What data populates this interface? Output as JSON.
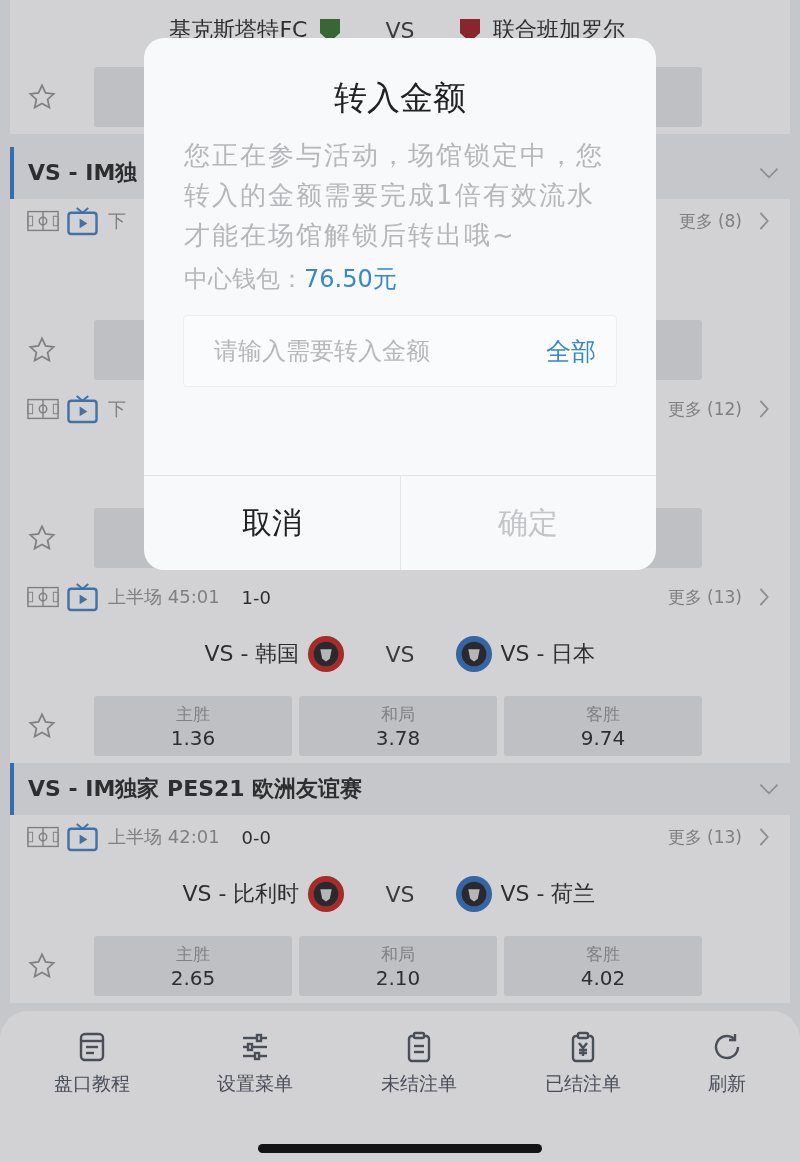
{
  "top_match": {
    "home": "基克斯塔特FC",
    "vs": "VS",
    "away": "联合班加罗尔"
  },
  "sections": [
    {
      "title": "VS - IM独",
      "matches": [
        {
          "status": "下",
          "more": "更多 (8)"
        },
        {
          "status": "下",
          "more": "更多 (12)"
        },
        {
          "status": "上半场 45:01",
          "score": "1-0",
          "more": "更多 (13)",
          "home": "VS - 韩国",
          "vs": "VS",
          "away": "VS - 日本",
          "odds": [
            {
              "label": "主胜",
              "value": "1.36"
            },
            {
              "label": "和局",
              "value": "3.78"
            },
            {
              "label": "客胜",
              "value": "9.74"
            }
          ]
        }
      ]
    },
    {
      "title": "VS - IM独家 PES21 欧洲友谊赛",
      "matches": [
        {
          "status": "上半场 42:01",
          "score": "0-0",
          "more": "更多 (13)",
          "home": "VS - 比利时",
          "vs": "VS",
          "away": "VS - 荷兰",
          "odds": [
            {
              "label": "主胜",
              "value": "2.65"
            },
            {
              "label": "和局",
              "value": "2.10"
            },
            {
              "label": "客胜",
              "value": "4.02"
            }
          ]
        }
      ]
    }
  ],
  "dialog": {
    "title": "转入金额",
    "message": "您正在参与活动，场馆锁定中，您转入的金额需要完成1倍有效流水才能在场馆解锁后转出哦~",
    "wallet_label": "中心钱包：",
    "wallet_value": "76.50元",
    "input": {
      "placeholder": "请输入需要转入金额"
    },
    "all_button": "全部",
    "buttons": [
      {
        "label": "取消",
        "disabled": false
      },
      {
        "label": "确定",
        "disabled": true
      }
    ]
  },
  "tab_bar": [
    {
      "kind": "guide",
      "label": "盘口教程"
    },
    {
      "kind": "settings",
      "label": "设置菜单"
    },
    {
      "kind": "open-bets",
      "label": "未结注单"
    },
    {
      "kind": "settled-bets",
      "label": "已结注单"
    },
    {
      "kind": "refresh",
      "label": "刷新"
    }
  ]
}
